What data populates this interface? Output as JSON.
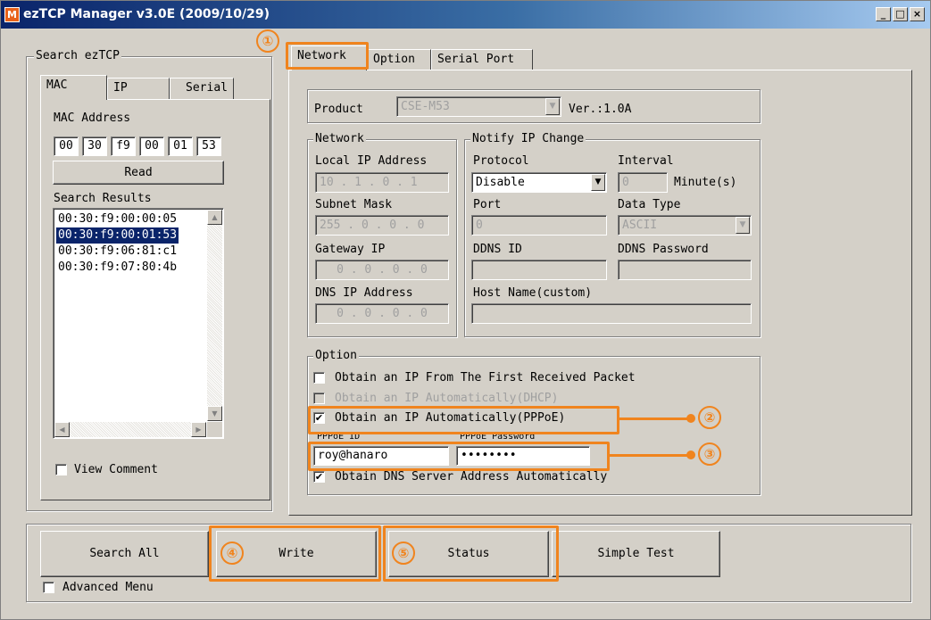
{
  "window": {
    "title": "ezTCP Manager v3.0E (2009/10/29)"
  },
  "search": {
    "group_title": "Search ezTCP",
    "tabs": [
      "MAC",
      "IP",
      "Serial"
    ],
    "mac_label": "MAC Address",
    "mac_octets": [
      "00",
      "30",
      "f9",
      "00",
      "01",
      "53"
    ],
    "read_button": "Read",
    "results_label": "Search Results",
    "results": [
      "00:30:f9:00:00:05",
      "00:30:f9:00:01:53",
      "00:30:f9:06:81:c1",
      "00:30:f9:07:80:4b"
    ],
    "selected_index": 1,
    "view_comment": "View Comment"
  },
  "main_tabs": [
    "Network",
    "Option",
    "Serial Port"
  ],
  "product": {
    "label": "Product",
    "value": "CSE-M53",
    "version": "Ver.:1.0A"
  },
  "network": {
    "group_title": "Network",
    "local_ip_label": "Local IP Address",
    "local_ip": "10 . 1 . 0 . 1",
    "subnet_label": "Subnet Mask",
    "subnet": "255 . 0 . 0 . 0",
    "gateway_label": "Gateway IP",
    "gateway": "0 . 0 . 0 . 0",
    "dns_label": "DNS IP Address",
    "dns": "0 . 0 . 0 . 0"
  },
  "notify": {
    "group_title": "Notify IP Change",
    "protocol_label": "Protocol",
    "protocol": "Disable",
    "interval_label": "Interval",
    "interval": "0",
    "interval_unit": "Minute(s)",
    "port_label": "Port",
    "port": "0",
    "data_type_label": "Data Type",
    "data_type": "ASCII",
    "ddns_id_label": "DDNS ID",
    "ddns_id": "",
    "ddns_password_label": "DDNS Password",
    "ddns_password": "",
    "host_name_label": "Host Name(custom)",
    "host_name": ""
  },
  "option": {
    "group_title": "Option",
    "first_packet": "Obtain an IP From The First Received Packet",
    "dhcp": "Obtain an IP Automatically(DHCP)",
    "pppoe": "Obtain an IP Automatically(PPPoE)",
    "pppoe_id_label": "PPPoE ID",
    "pppoe_id": "roy@hanaro",
    "pppoe_password_label": "PPPoE Password",
    "pppoe_password": "••••••••",
    "dns_auto": "Obtain DNS Server Address Automatically"
  },
  "actions": {
    "search_all": "Search All",
    "write": "Write",
    "status": "Status",
    "simple_test": "Simple Test",
    "advanced_menu": "Advanced Menu"
  },
  "callouts": [
    "①",
    "②",
    "③",
    "④",
    "⑤"
  ],
  "accent_color": "#f0841e",
  "title_color": "#0a246a"
}
